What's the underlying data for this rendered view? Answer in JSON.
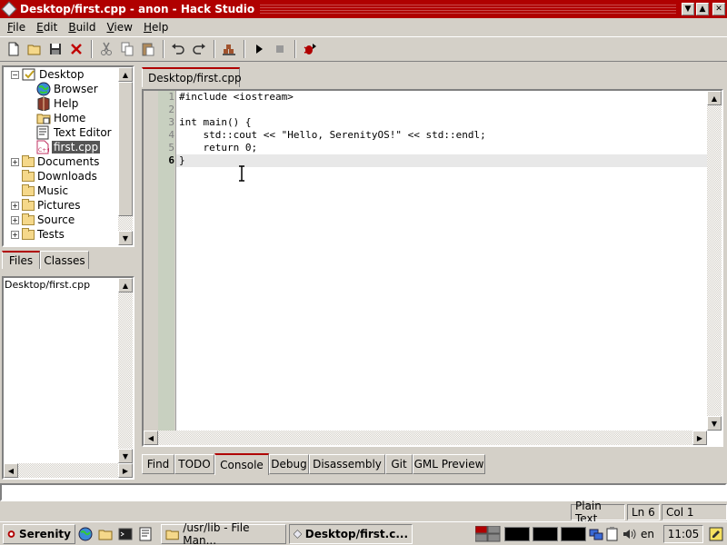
{
  "window": {
    "title": "Desktop/first.cpp - anon - Hack Studio"
  },
  "window_controls": {
    "minimize": "▼",
    "maximize": "▲",
    "close": "✕"
  },
  "menubar": [
    {
      "label": "File",
      "underline": "F",
      "rest": "ile"
    },
    {
      "label": "Edit",
      "underline": "E",
      "rest": "dit"
    },
    {
      "label": "Build",
      "underline": "B",
      "rest": "uild"
    },
    {
      "label": "View",
      "underline": "V",
      "rest": "iew"
    },
    {
      "label": "Help",
      "underline": "H",
      "rest": "elp"
    }
  ],
  "toolbar": {
    "icons": [
      "new-file-icon",
      "open-folder-icon",
      "save-icon",
      "delete-icon",
      "cut-icon",
      "copy-icon",
      "paste-icon",
      "undo-icon",
      "redo-icon",
      "build-icon",
      "run-icon",
      "stop-icon",
      "debug-icon"
    ]
  },
  "tree": {
    "items": [
      {
        "label": "Desktop",
        "depth": 0,
        "expander": "−",
        "icon": "desktop-icon"
      },
      {
        "label": "Browser",
        "depth": 1,
        "icon": "browser-icon"
      },
      {
        "label": "Help",
        "depth": 1,
        "icon": "help-book-icon"
      },
      {
        "label": "Home",
        "depth": 1,
        "icon": "home-folder-icon"
      },
      {
        "label": "Text Editor",
        "depth": 1,
        "icon": "text-editor-icon"
      },
      {
        "label": "first.cpp",
        "depth": 1,
        "icon": "cpp-file-icon",
        "selected": true
      },
      {
        "label": "Documents",
        "depth": 0,
        "expander": "+",
        "icon": "folder-icon"
      },
      {
        "label": "Downloads",
        "depth": 0,
        "icon": "folder-icon"
      },
      {
        "label": "Music",
        "depth": 0,
        "icon": "folder-icon"
      },
      {
        "label": "Pictures",
        "depth": 0,
        "expander": "+",
        "icon": "folder-icon"
      },
      {
        "label": "Source",
        "depth": 0,
        "expander": "+",
        "icon": "folder-icon"
      },
      {
        "label": "Tests",
        "depth": 0,
        "expander": "+",
        "icon": "folder-icon"
      }
    ]
  },
  "left_tabs": [
    {
      "label": "Files",
      "active": true
    },
    {
      "label": "Classes",
      "active": false
    }
  ],
  "open_files": [
    "Desktop/first.cpp"
  ],
  "editor": {
    "tab_label": "Desktop/first.cpp",
    "current_line": 6,
    "lines": [
      "#include <iostream>",
      "",
      "int main() {",
      "    std::cout << \"Hello, SerenityOS!\" << std::endl;",
      "    return 0;",
      "}"
    ]
  },
  "bottom_tabs": [
    {
      "label": "Find",
      "active": false
    },
    {
      "label": "TODO",
      "active": false
    },
    {
      "label": "Console",
      "active": true
    },
    {
      "label": "Debug",
      "active": false
    },
    {
      "label": "Disassembly",
      "active": false
    },
    {
      "label": "Git",
      "active": false
    },
    {
      "label": "GML Preview",
      "active": false
    }
  ],
  "status": {
    "language": "Plain Text",
    "line": "Ln 6",
    "column": "Col 1"
  },
  "taskbar": {
    "start_label": "Serenity",
    "tasks": [
      {
        "label": "/usr/lib - File Man...",
        "active": false
      },
      {
        "label": "Desktop/first.c...",
        "active": true
      }
    ],
    "keyboard_layout": "en",
    "clock": "11:05"
  },
  "colors": {
    "titlebar": "#b00000",
    "accent": "#b00000",
    "selection": "#555555"
  }
}
